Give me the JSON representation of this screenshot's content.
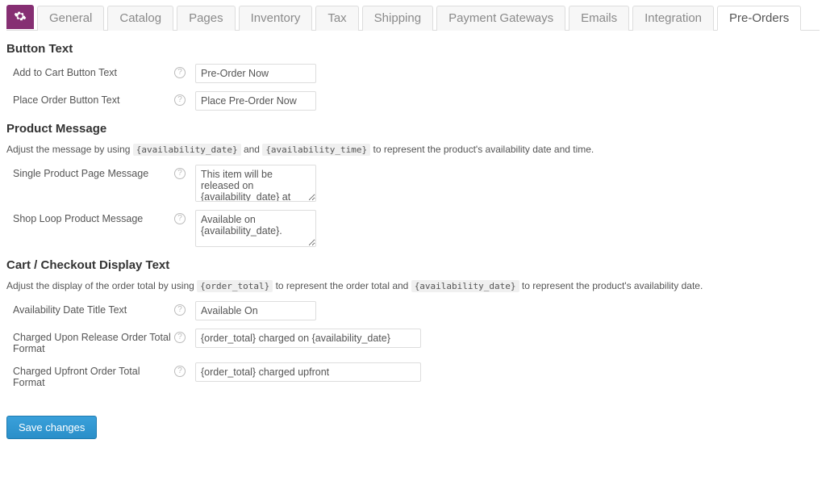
{
  "tabs": {
    "t0": "General",
    "t1": "Catalog",
    "t2": "Pages",
    "t3": "Inventory",
    "t4": "Tax",
    "t5": "Shipping",
    "t6": "Payment Gateways",
    "t7": "Emails",
    "t8": "Integration",
    "t9": "Pre-Orders"
  },
  "sections": {
    "button_text": {
      "title": "Button Text",
      "fields": {
        "add_to_cart": {
          "label": "Add to Cart Button Text",
          "value": "Pre-Order Now"
        },
        "place_order": {
          "label": "Place Order Button Text",
          "value": "Place Pre-Order Now"
        }
      }
    },
    "product_message": {
      "title": "Product Message",
      "desc_parts": {
        "p1": "Adjust the message by using ",
        "token1": "{availability_date}",
        "p2": " and ",
        "token2": "{availability_time}",
        "p3": " to represent the product's availability date and time."
      },
      "fields": {
        "single_product": {
          "label": "Single Product Page Message",
          "value": "This item will be released on {availability_date} at"
        },
        "shop_loop": {
          "label": "Shop Loop Product Message",
          "value": "Available on {availability_date}."
        }
      }
    },
    "cart_checkout": {
      "title": "Cart / Checkout Display Text",
      "desc_parts": {
        "p1": "Adjust the display of the order total by using ",
        "token1": "{order_total}",
        "p2": " to represent the order total and ",
        "token2": "{availability_date}",
        "p3": " to represent the product's availability date."
      },
      "fields": {
        "avail_title": {
          "label": "Availability Date Title Text",
          "value": "Available On"
        },
        "charged_release": {
          "label": "Charged Upon Release Order Total Format",
          "value": "{order_total} charged on {availability_date}"
        },
        "charged_upfront": {
          "label": "Charged Upfront Order Total Format",
          "value": "{order_total} charged upfront"
        }
      }
    }
  },
  "buttons": {
    "save": "Save changes"
  }
}
